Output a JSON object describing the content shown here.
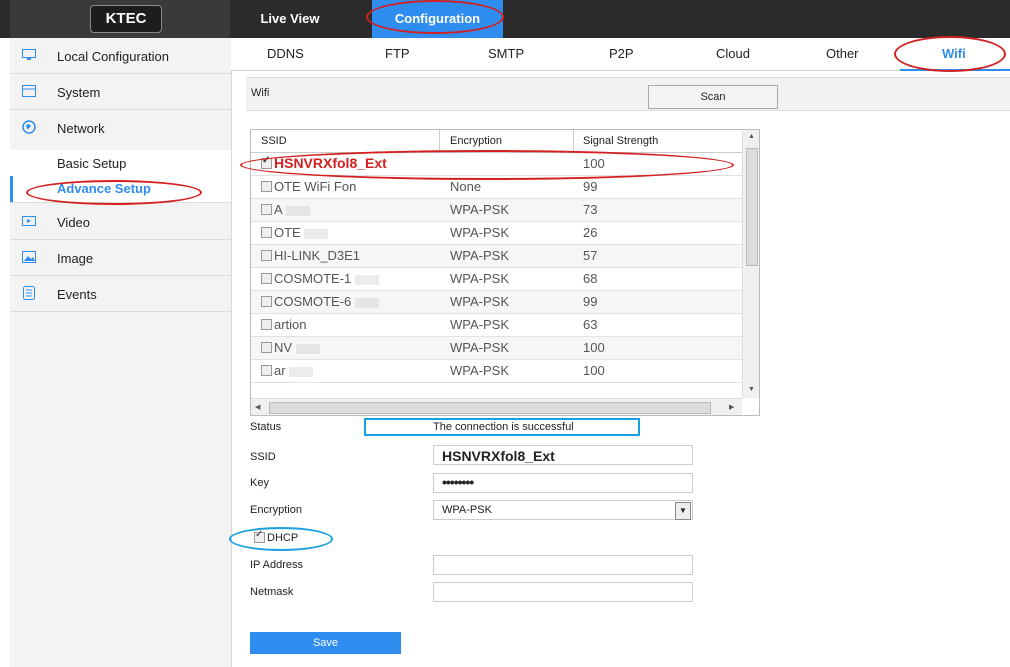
{
  "header": {
    "logo": "KTEC",
    "nav": [
      "Live View",
      "Configuration"
    ]
  },
  "sidebar": {
    "items": [
      {
        "label": "Local Configuration",
        "icon": "monitor-icon"
      },
      {
        "label": "System",
        "icon": "system-icon"
      },
      {
        "label": "Network",
        "icon": "globe-icon"
      },
      {
        "label": "Basic Setup"
      },
      {
        "label": "Advance Setup"
      },
      {
        "label": "Video",
        "icon": "video-icon"
      },
      {
        "label": "Image",
        "icon": "image-icon"
      },
      {
        "label": "Events",
        "icon": "events-icon"
      }
    ]
  },
  "subtabs": [
    "DDNS",
    "FTP",
    "SMTP",
    "P2P",
    "Cloud",
    "Other",
    "Wifi"
  ],
  "wifi": {
    "section_label": "Wifi",
    "scan_label": "Scan"
  },
  "table": {
    "headers": [
      "SSID",
      "Encryption",
      "Signal Strength"
    ],
    "rows": [
      {
        "ssid": "HSNVRXfol8_Ext",
        "encryption": "",
        "signal": "100"
      },
      {
        "ssid": "OTE WiFi Fon",
        "encryption": "None",
        "signal": "99"
      },
      {
        "ssid": "A",
        "encryption": "WPA-PSK",
        "signal": "73"
      },
      {
        "ssid": "OTE",
        "encryption": "WPA-PSK",
        "signal": "26"
      },
      {
        "ssid": "HI-LINK_D3E1",
        "encryption": "WPA-PSK",
        "signal": "57"
      },
      {
        "ssid": "COSMOTE-1",
        "encryption": "WPA-PSK",
        "signal": "68"
      },
      {
        "ssid": "COSMOTE-6",
        "encryption": "WPA-PSK",
        "signal": "99"
      },
      {
        "ssid": "artion",
        "encryption": "WPA-PSK",
        "signal": "63"
      },
      {
        "ssid": "NV",
        "encryption": "WPA-PSK",
        "signal": "100"
      },
      {
        "ssid": "ar",
        "encryption": "WPA-PSK",
        "signal": "100"
      }
    ]
  },
  "form": {
    "status_label": "Status",
    "status_value": "The connection is successful",
    "ssid_label": "SSID",
    "ssid_value": "HSNVRXfol8_Ext",
    "key_label": "Key",
    "key_value": "••••••••",
    "encryption_label": "Encryption",
    "encryption_value": "WPA-PSK",
    "dhcp_label": "DHCP",
    "ip_label": "IP Address",
    "ip_value": "",
    "netmask_label": "Netmask",
    "netmask_value": "",
    "save_label": "Save"
  },
  "colors": {
    "accent": "#2f8df0",
    "annotation_red": "#d42020",
    "annotation_blue": "#1aa0e0"
  }
}
